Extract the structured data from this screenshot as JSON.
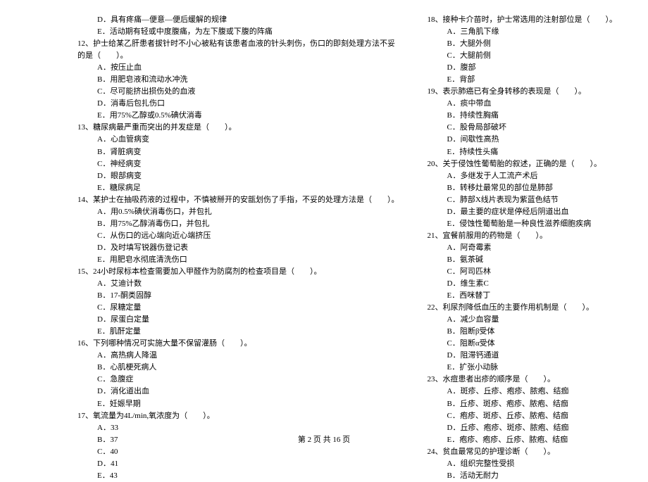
{
  "left": {
    "pre": [
      "D．具有疼痛—便意—便后缓解的规律",
      "E．活动期有轻或中度腹痛，为左下腹或下腹的阵痛"
    ],
    "q12": "12、护士给某乙肝患者拔针时不小心被粘有该患者血液的针头刺伤，伤口的即刻处理方法不妥",
    "q12b": "的是（　　）。",
    "q12opts": [
      "A．按压止血",
      "B．用肥皂液和流动水冲洗",
      "C．尽可能挤出损伤处的血液",
      "D．消毒后包扎伤口",
      "E．用75%乙醇或0.5%碘伏消毒"
    ],
    "q13": "13、糖尿病最严重而突出的并发症是（　　）。",
    "q13opts": [
      "A．心血管病变",
      "B．肾脏病变",
      "C．神经病变",
      "D．眼部病变",
      "E．糖尿病足"
    ],
    "q14": "14、某护士在抽吸药液的过程中，不慎被掰开的安瓿划伤了手指，不妥的处理方法是（　　）。",
    "q14opts": [
      "A．用0.5%碘伏消毒伤口，并包扎",
      "B．用75%乙醇消毒伤口，并包扎",
      "C．从伤口的远心端向近心端挤压",
      "D．及时填写锐器伤登记表",
      "E．用肥皂水彻底清洗伤口"
    ],
    "q15": "15、24小时尿标本检查需要加入甲醛作为防腐剂的检查项目是（　　）。",
    "q15opts": [
      "A．艾迪计数",
      "B．17-酮类固醇",
      "C．尿糖定量",
      "D．尿蛋白定量",
      "E．肌酐定量"
    ],
    "q16": "16、下列哪种情况可实施大量不保留灌肠（　　）。",
    "q16opts": [
      "A．高热病人降温",
      "B．心肌梗死病人",
      "C．急腹症",
      "D．消化道出血",
      "E．妊娠早期"
    ],
    "q17": "17、氧流量为4L/min,氧浓度为（　　）。",
    "q17opts": [
      "A．33",
      "B．37",
      "C．40",
      "D．41",
      "E．43"
    ]
  },
  "right": {
    "q18": "18、接种卡介苗时，护士常选用的注射部位是（　　）。",
    "q18opts": [
      "A．三角肌下缘",
      "B．大腿外侧",
      "C．大腿前侧",
      "D．腹部",
      "E．背部"
    ],
    "q19": "19、表示肺癌已有全身转移的表现是（　　）。",
    "q19opts": [
      "A．痰中带血",
      "B．持续性胸痛",
      "C．股骨局部破坏",
      "D．间歇性高热",
      "E．持续性头痛"
    ],
    "q20": "20、关于侵蚀性葡萄胎的叙述，正确的是（　　）。",
    "q20opts": [
      "A．多继发于人工流产术后",
      "B．转移灶最常见的部位是肺部",
      "C．肺部X线片表现为紫蓝色结节",
      "D．最主要的症状是停经后阴道出血",
      "E．侵蚀性葡萄胎是一种良性滋养细胞疾病"
    ],
    "q21": "21、宜餐前服用的药物是（　　）。",
    "q21opts": [
      "A．阿奇霉素",
      "B．氨茶碱",
      "C．阿司匹林",
      "D．维生素C",
      "E．西咪替丁"
    ],
    "q22": "22、利尿剂降低血压的主要作用机制是（　　）。",
    "q22opts": [
      "A．减少血容量",
      "B．阻断β受体",
      "C．阻断α受体",
      "D．阻滞钙通道",
      "E．扩张小动脉"
    ],
    "q23": "23、水痘患者出疹的顺序是（　　）。",
    "q23opts": [
      "A．斑疹、丘疹、疱疹、脓疱、结痂",
      "B．丘疹、斑疹、疱疹、脓疱、结痂",
      "C．疱疹、斑疹、丘疹、脓疱、结痂",
      "D．丘疹、疱疹、斑疹、脓疱、结痂",
      "E．疱疹、疱疹、丘疹、脓疱、结痂"
    ],
    "q24": "24、贫血最常见的护理诊断（　　）。",
    "q24opts": [
      "A．组织完整性受损",
      "B．活动无耐力"
    ]
  },
  "footer": "第 2 页 共 16 页"
}
